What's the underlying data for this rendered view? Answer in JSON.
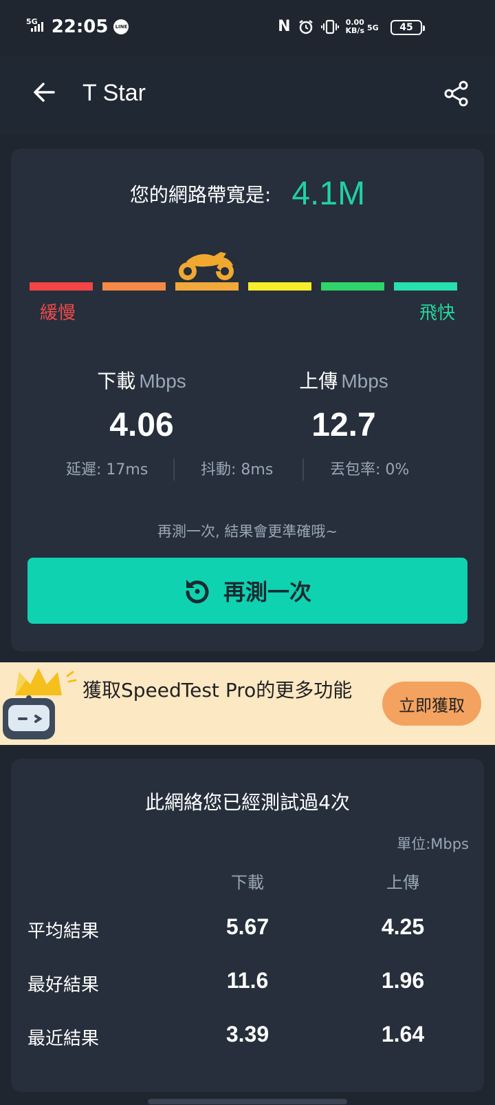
{
  "status_bar": {
    "network": "5G",
    "time": "22:05",
    "line_app": "LINE",
    "nfc": "N",
    "speed_value": "0.00",
    "speed_unit": "KB/s",
    "network_right": "5G",
    "battery": "45"
  },
  "app_bar": {
    "title": "T Star",
    "back_icon": "arrow-left-icon",
    "share_icon": "share-icon"
  },
  "result": {
    "bandwidth_label": "您的網路帶寬是:",
    "bandwidth_value": "4.1M",
    "scale_slow": "緩慢",
    "scale_fast": "飛快",
    "scale_colors": [
      "#f24545",
      "#f58a46",
      "#f2a93b",
      "#f6ee2b",
      "#2fd46a",
      "#27e0ad"
    ],
    "scale_level_index": 2,
    "download_label": "下載",
    "download_unit": "Mbps",
    "download_value": "4.06",
    "upload_label": "上傳",
    "upload_unit": "Mbps",
    "upload_value": "12.7",
    "latency": "延遲: 17ms",
    "jitter": "抖動: 8ms",
    "packet_loss": "丟包率:  0%",
    "hint": "再測一次, 結果會更準確哦~",
    "retest_label": "再測一次"
  },
  "promo": {
    "text": "獲取SpeedTest Pro的更多功能",
    "button": "立即獲取"
  },
  "history": {
    "title": "此網絡您已經測試過4次",
    "unit": "單位:Mbps",
    "col_download": "下載",
    "col_upload": "上傳",
    "rows": [
      {
        "label": "平均結果",
        "download": "5.67",
        "upload": "4.25"
      },
      {
        "label": "最好結果",
        "download": "11.6",
        "upload": "1.96"
      },
      {
        "label": "最近結果",
        "download": "3.39",
        "upload": "1.64"
      }
    ]
  },
  "colors": {
    "background": "#1f2630",
    "card": "#262f3b",
    "accent": "#1fd1a7",
    "button": "#0fd2b1",
    "promo_bg": "#fde8c4",
    "promo_button": "#f4a25f"
  }
}
